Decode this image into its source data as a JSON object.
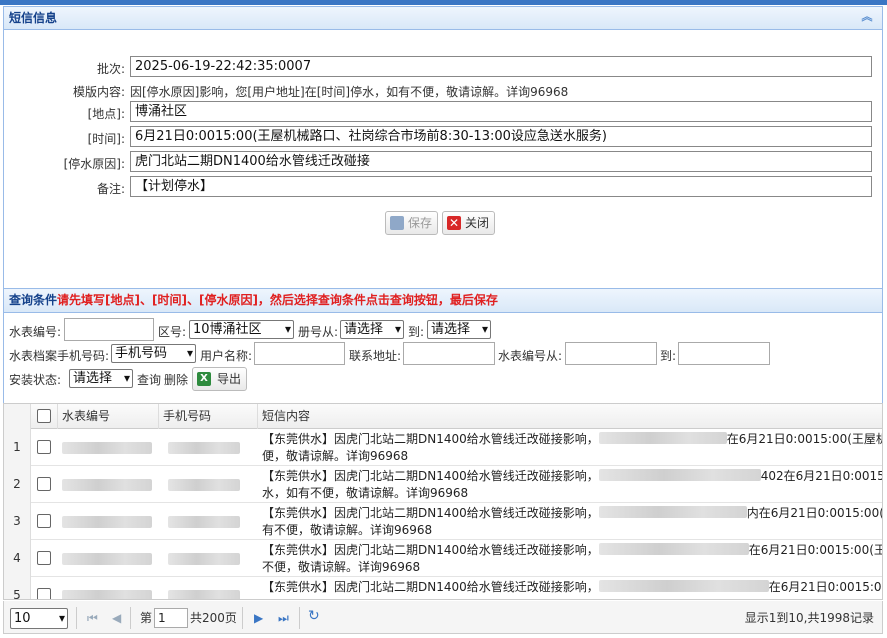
{
  "panel1": {
    "title": "短信信息"
  },
  "form": {
    "batch_label": "批次:",
    "batch_value": "2025-06-19-22:42:35:0007",
    "template_label": "模版内容:",
    "template_value": "因[停水原因]影响，您[用户地址]在[时间]停水，如有不便，敬请谅解。详询96968",
    "place_label": "[地点]:",
    "place_value": "博涌社区",
    "time_label": "[时间]:",
    "time_value": "6月21日0:0015:00(王屋机械路口、社岗综合市场前8:30-13:00设应急送水服务)",
    "reason_label": "[停水原因]:",
    "reason_value": "虎门北站二期DN1400给水管线迁改碰接",
    "remark_label": "备注:",
    "remark_value": "【计划停水】",
    "save_label": "保存",
    "close_label": "关闭"
  },
  "panel2": {
    "title_prefix": "查询条件",
    "title_hint": "请先填写[地点]、[时间]、[停水原因]，然后选择查询条件点击查询按钮，最后保存"
  },
  "query": {
    "meter_no_label": "水表编号:",
    "district_label": "区号:",
    "district_value": "10博涌社区",
    "book_from_label": "册号从:",
    "book_from_value": "请选择",
    "to1_label": "到:",
    "to1_value": "请选择",
    "phone_label": "水表档案手机号码:",
    "phone_value": "手机号码",
    "username_label": "用户名称:",
    "address_label": "联系地址:",
    "meter_from_label": "水表编号从:",
    "to2_label": "到:",
    "install_label": "安装状态:",
    "install_value": "请选择",
    "query_label": "查询",
    "delete_label": "删除",
    "export_label": "导出"
  },
  "grid": {
    "columns": [
      "水表编号",
      "手机号码",
      "短信内容"
    ],
    "rows": [
      {
        "num": "1",
        "line1": "【东莞供水】因虎门北站二期DN1400给水管线迁改碰接影响，",
        "tail": "在6月21日0:0015:00(王屋机械",
        "line2": ""
      },
      {
        "num": "2",
        "line1": "【东莞供水】因虎门北站二期DN1400给水管线迁改碰接影响，",
        "tail": "402在6月21日0:0015:",
        "line2": "水，如有不便，敬请谅解。详询96968"
      },
      {
        "num": "3",
        "line1": "【东莞供水】因虎门北站二期DN1400给水管线迁改碰接影响，",
        "tail": "内在6月21日0:0015:00(王",
        "line2": "有不便，敬请谅解。详询96968"
      },
      {
        "num": "4",
        "line1": "【东莞供水】因虎门北站二期DN1400给水管线迁改碰接影响，",
        "tail": "在6月21日0:0015:00(王屋",
        "line2": "不便，敬请谅解。详询96968"
      },
      {
        "num": "5",
        "line1": "【东莞供水】因虎门北站二期DN1400给水管线迁改碰接影响，",
        "tail": "在6月21日0:0015:00(",
        "line2": ""
      }
    ],
    "first_row_line2": "便，敬请谅解。详询96968"
  },
  "pager": {
    "page_size": "10",
    "page_prefix": "第",
    "page_value": "1",
    "page_total": "共200页",
    "summary": "显示1到10,共1998记录"
  }
}
